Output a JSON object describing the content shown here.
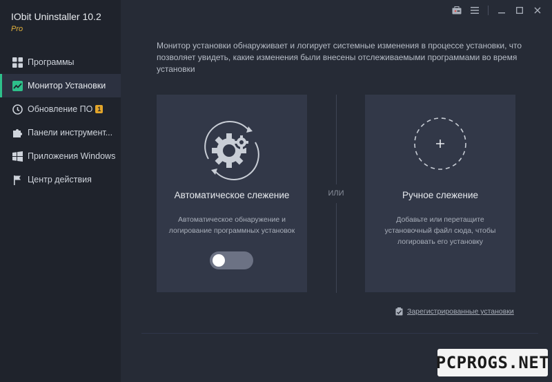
{
  "app": {
    "title": "IObit Uninstaller 10.2",
    "edition": "Pro"
  },
  "sidebar": {
    "items": [
      {
        "label": "Программы",
        "icon": "grid-icon"
      },
      {
        "label": "Монитор Установки",
        "icon": "chart-icon",
        "active": true
      },
      {
        "label": "Обновление ПО",
        "icon": "update-icon",
        "badge": "1"
      },
      {
        "label": "Панели инструмент...",
        "icon": "puzzle-icon"
      },
      {
        "label": "Приложения Windows",
        "icon": "windows-icon"
      },
      {
        "label": "Центр действия",
        "icon": "flag-icon"
      }
    ]
  },
  "main": {
    "description": "Монитор установки обнаруживает и логирует системные изменения в процессе установки, что позволяет увидеть, какие изменения были внесены отслеживаемыми программами во время установки",
    "auto": {
      "title": "Автоматическое слежение",
      "description": "Автоматическое обнаружение и логирование программных установок",
      "toggle_on": false
    },
    "or_label": "ИЛИ",
    "manual": {
      "title": "Ручное слежение",
      "description": "Добавьте или перетащите установочный файл сюда, чтобы логировать его установку"
    },
    "registered_link": "Зарегистрированные установки"
  },
  "watermark": "PCPROGS.NET",
  "colors": {
    "accent": "#2ec08a",
    "badge": "#e3a52a",
    "edition": "#e3b23c"
  }
}
